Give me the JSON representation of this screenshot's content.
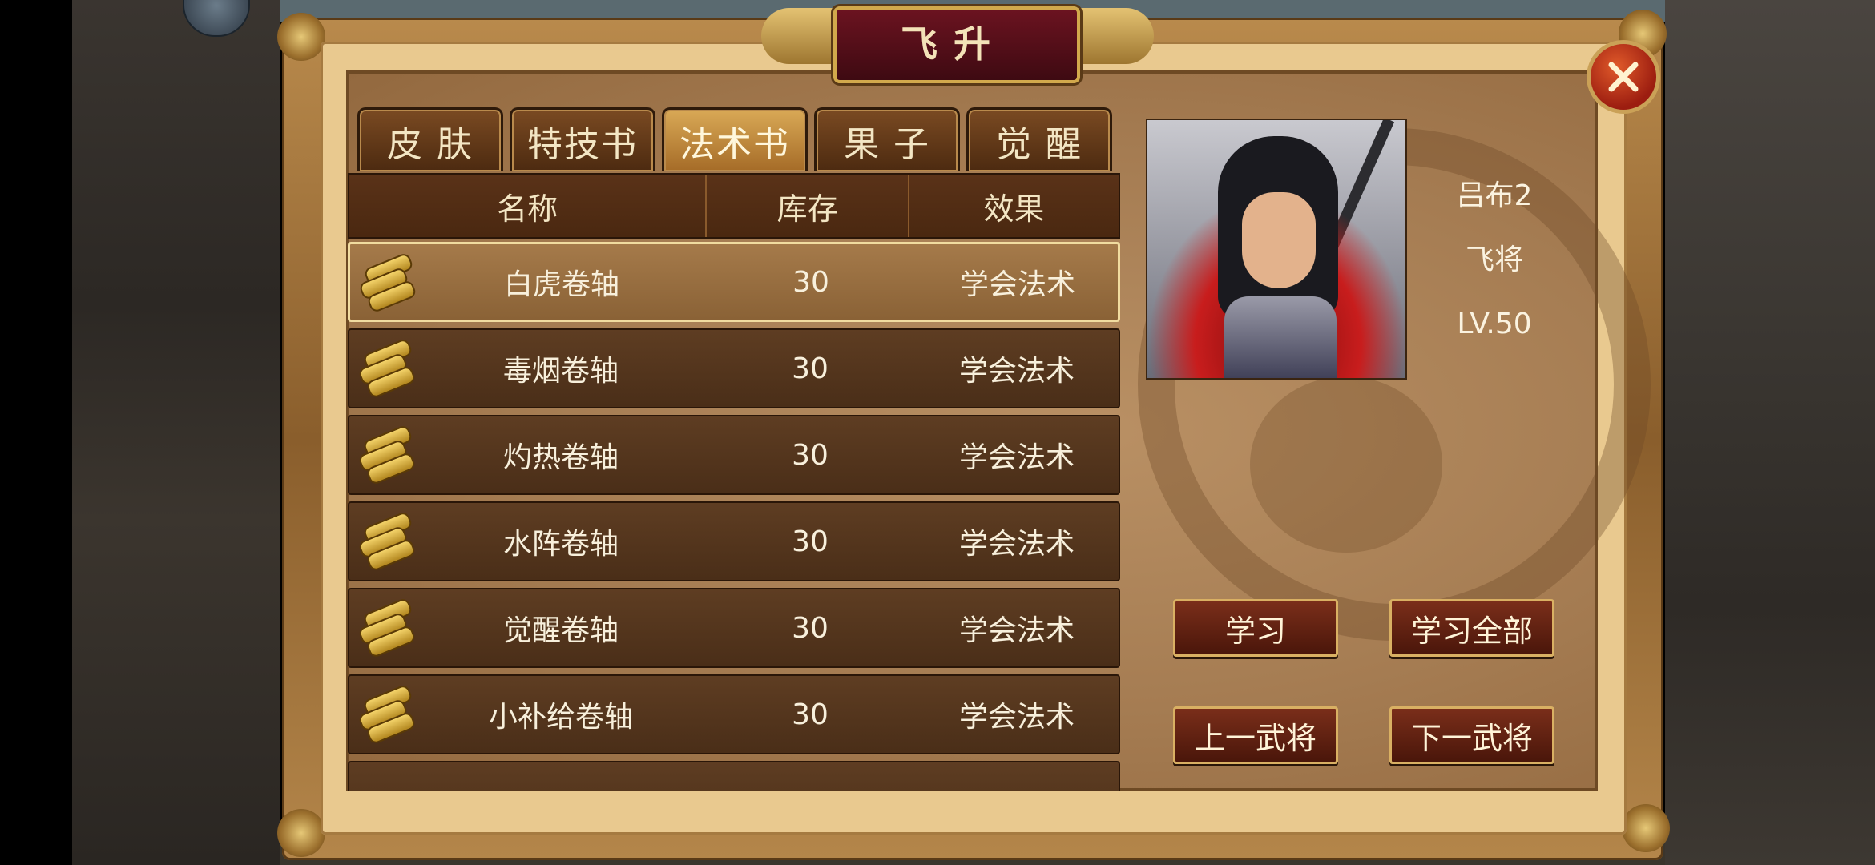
{
  "window": {
    "title": "飞升"
  },
  "tabs": [
    {
      "label": "皮 肤",
      "active": false
    },
    {
      "label": "特技书",
      "active": false
    },
    {
      "label": "法术书",
      "active": true
    },
    {
      "label": "果 子",
      "active": false
    },
    {
      "label": "觉 醒",
      "active": false
    }
  ],
  "table": {
    "headers": [
      "名称",
      "库存",
      "效果"
    ],
    "rows": [
      {
        "icon": "scroll-icon",
        "name": "白虎卷轴",
        "stock": "30",
        "effect": "学会法术",
        "selected": true
      },
      {
        "icon": "scroll-icon",
        "name": "毒烟卷轴",
        "stock": "30",
        "effect": "学会法术",
        "selected": false
      },
      {
        "icon": "scroll-icon",
        "name": "灼热卷轴",
        "stock": "30",
        "effect": "学会法术",
        "selected": false
      },
      {
        "icon": "scroll-icon",
        "name": "水阵卷轴",
        "stock": "30",
        "effect": "学会法术",
        "selected": false
      },
      {
        "icon": "scroll-icon",
        "name": "觉醒卷轴",
        "stock": "30",
        "effect": "学会法术",
        "selected": false
      },
      {
        "icon": "scroll-icon",
        "name": "小补给卷轴",
        "stock": "30",
        "effect": "学会法术",
        "selected": false
      }
    ]
  },
  "hero": {
    "name": "吕布2",
    "role": "飞将",
    "level": "LV.50"
  },
  "buttons": {
    "learn": "学习",
    "learn_all": "学习全部",
    "prev_general": "上一武将",
    "next_general": "下一武将"
  },
  "colors": {
    "panel": "#a57c52",
    "frame_gold": "#d2a94c",
    "title_red": "#6b1320",
    "button_red": "#7a2e1a",
    "close_red": "#c8301a"
  }
}
